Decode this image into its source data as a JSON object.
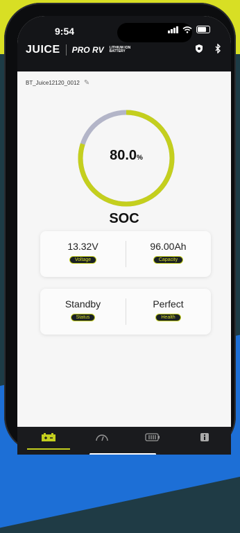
{
  "status": {
    "time": "9:54"
  },
  "brand": {
    "logo": "JUICE",
    "product": "PRO RV",
    "sub1": "LITHIUM ION",
    "sub2": "BATTERY"
  },
  "device": {
    "name": "BT_Juice12120_0012"
  },
  "soc": {
    "value": "80.0",
    "unit": "%",
    "label": "SOC",
    "fraction": 0.8
  },
  "cards": [
    {
      "left_value": "13.32V",
      "left_label": "Voltage",
      "right_value": "96.00Ah",
      "right_label": "Capacity"
    },
    {
      "left_value": "Standby",
      "left_label": "Status",
      "right_value": "Perfect",
      "right_label": "Health"
    }
  ],
  "tabs": [
    {
      "name": "battery-tab-icon",
      "active": true
    },
    {
      "name": "gauge-tab-icon",
      "active": false
    },
    {
      "name": "cells-tab-icon",
      "active": false
    },
    {
      "name": "info-tab-icon",
      "active": false
    }
  ],
  "colors": {
    "accent": "#c4cf1e",
    "gauge_track": "#b3b5c8",
    "dark": "#141518"
  }
}
